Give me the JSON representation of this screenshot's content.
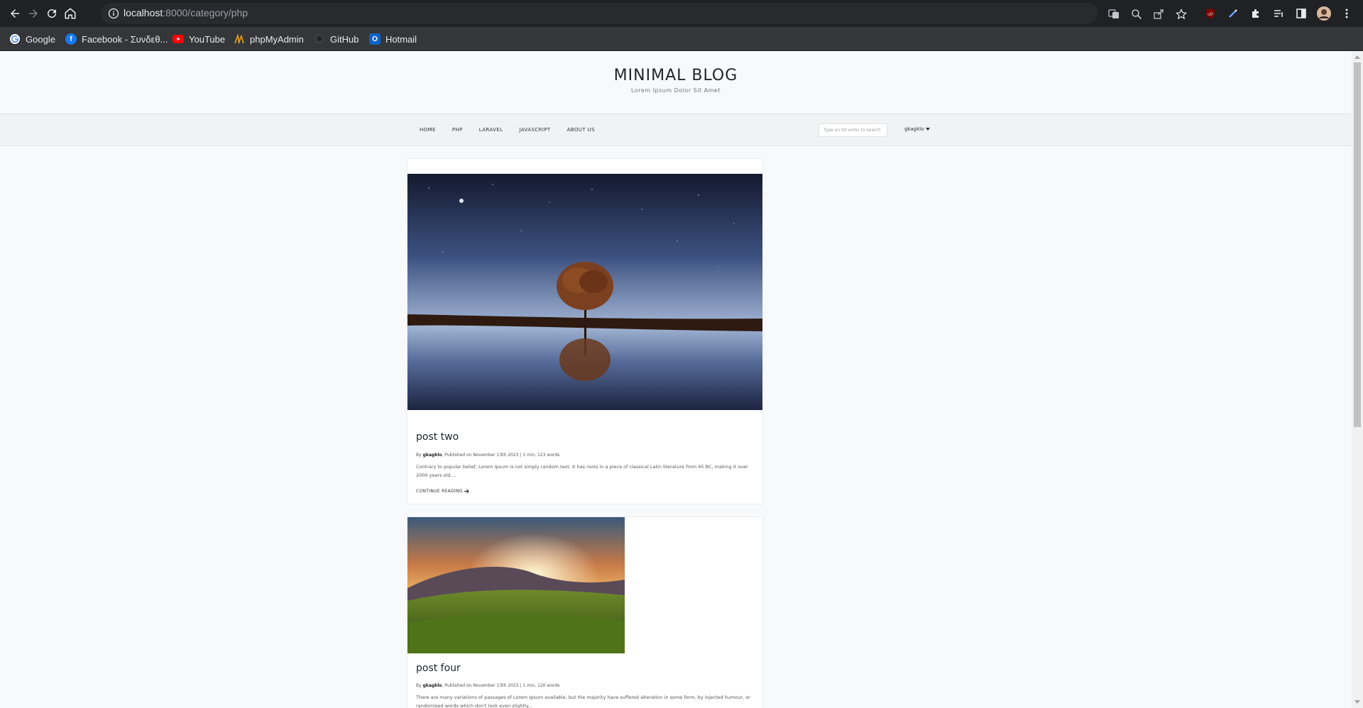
{
  "browser": {
    "url_host": "localhost",
    "url_path": ":8000/category/php",
    "bookmarks": [
      {
        "label": "Google",
        "icon": "google-icon"
      },
      {
        "label": "Facebook - Συνδεθ...",
        "icon": "facebook-icon"
      },
      {
        "label": "YouTube",
        "icon": "youtube-icon"
      },
      {
        "label": "phpMyAdmin",
        "icon": "phpmyadmin-icon"
      },
      {
        "label": "GitHub",
        "icon": "github-icon"
      },
      {
        "label": "Hotmail",
        "icon": "outlook-icon"
      }
    ],
    "colors": {
      "chrome": "#202124",
      "bookmarks_bar": "#35363a",
      "omnibox": "#292a2d"
    }
  },
  "site": {
    "title": "MINIMAL BLOG",
    "tagline": "Lorem Ipsum Dolor Sit Amet",
    "menu": [
      "HOME",
      "PHP",
      "LARAVEL",
      "JAVASCRIPT",
      "ABOUT US"
    ],
    "search_placeholder": "Type an hit enter to search",
    "user": "gkagklo"
  },
  "posts": [
    {
      "title": "post two",
      "by": "By",
      "author": "gkagklo",
      "meta": ", Published on November 13th 2023 | 1 min, 123 words",
      "excerpt": "Contrary to popular belief, Lorem Ipsum is not simply random text. It has roots in a piece of classical Latin literature from 45 BC, making it over 2000 years old....",
      "cta": "CONTINUE READING",
      "image": "night-lake-tree"
    },
    {
      "title": "post four",
      "by": "By",
      "author": "gkagklo",
      "meta": ", Published on November 13th 2023 | 1 min, 120 words",
      "excerpt": "There are many variations of passages of Lorem Ipsum available, but the majority have suffered alteration in some form, by injected humour, or randomised words which don't look even slightly...",
      "image": "sunset-meadow"
    }
  ]
}
